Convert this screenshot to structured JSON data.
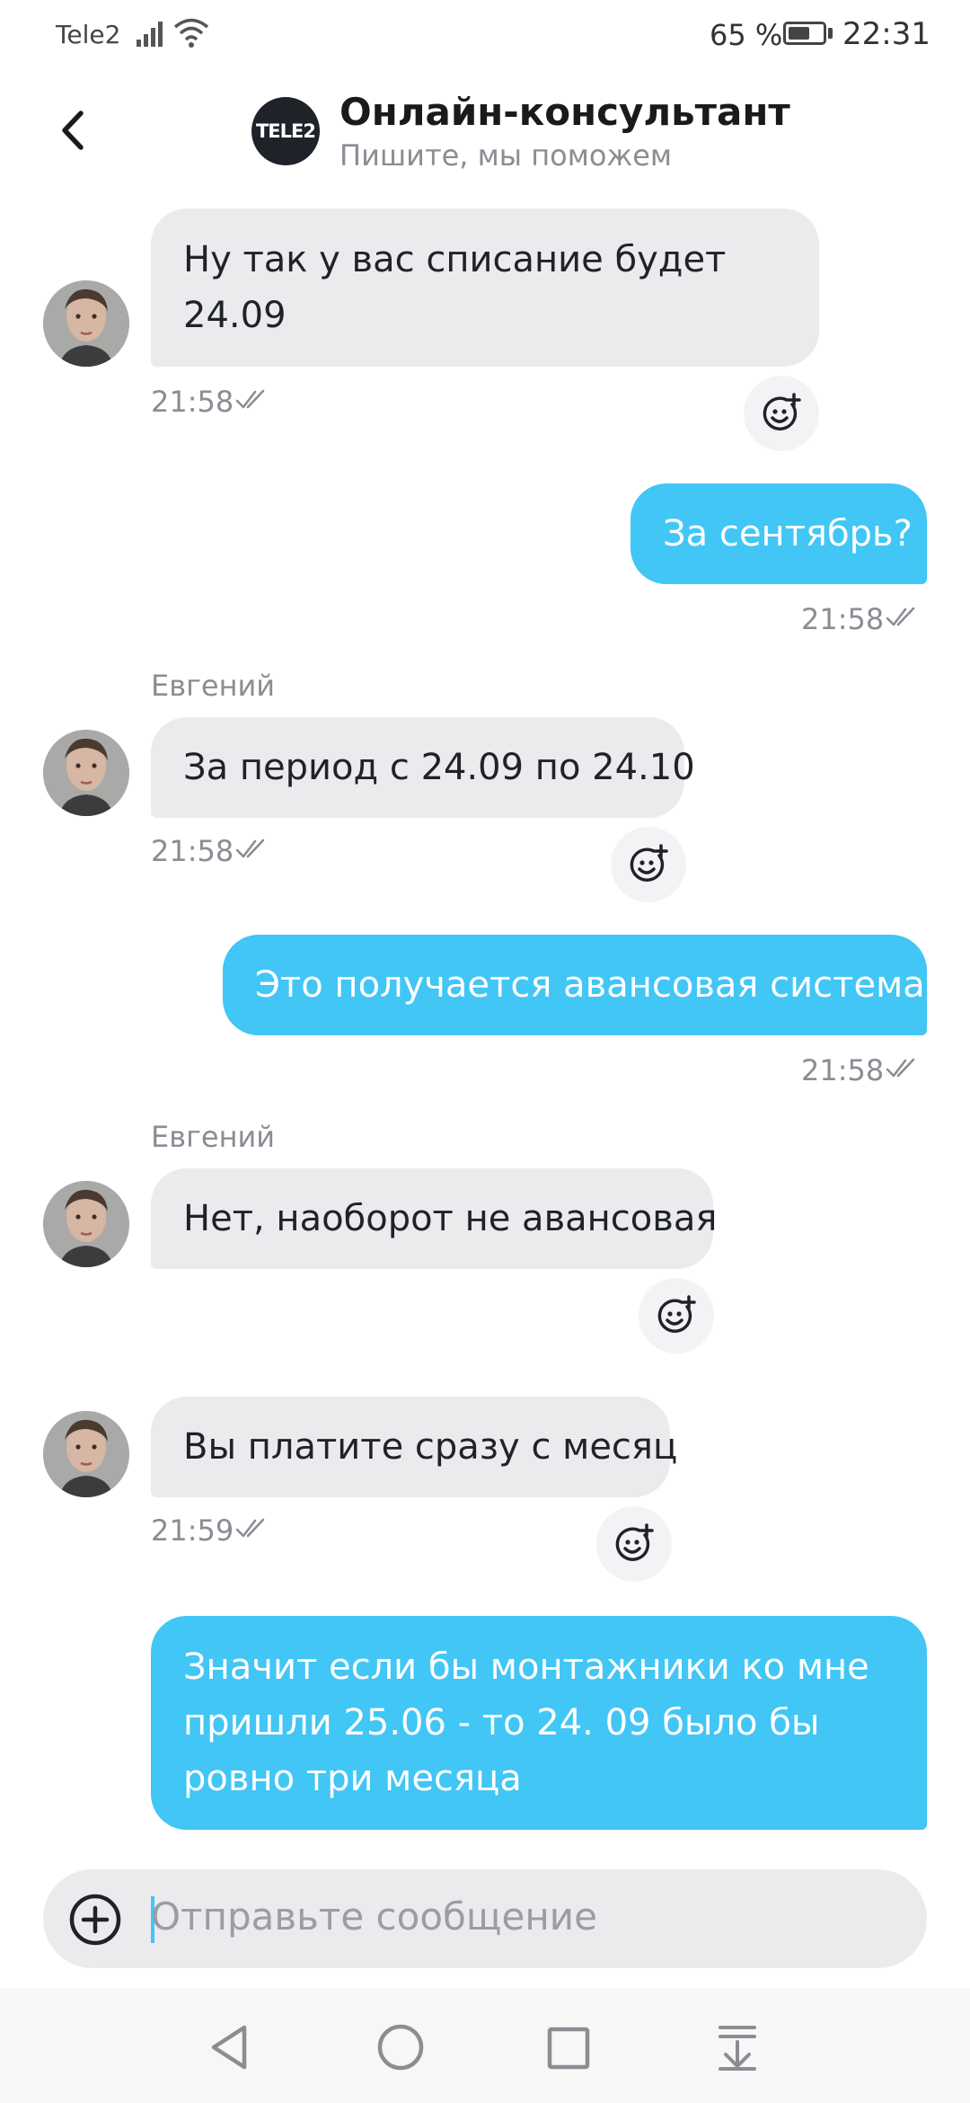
{
  "status_bar": {
    "carrier": "Tele2",
    "battery_percent": "65 %",
    "battery_level": 0.65,
    "time": "22:31"
  },
  "header": {
    "logo_text": "TELE2",
    "title": "Онлайн-консультант",
    "subtitle": "Пишите, мы поможем"
  },
  "messages": [
    {
      "direction": "in",
      "lines": [
        "Ну так у вас списание будет",
        "24.09"
      ],
      "time": "21:58"
    },
    {
      "direction": "out",
      "lines": [
        "За сентябрь?"
      ],
      "time": "21:58"
    },
    {
      "direction": "in",
      "sender": "Евгений",
      "lines": [
        "За период с 24.09 по 24.10"
      ],
      "time": "21:58"
    },
    {
      "direction": "out",
      "lines": [
        "Это получается авансовая система?"
      ],
      "time": "21:58"
    },
    {
      "direction": "in",
      "sender": "Евгений",
      "lines": [
        "Нет, наоборот не авансовая"
      ]
    },
    {
      "direction": "in",
      "lines": [
        "Вы платите сразу с месяц"
      ],
      "time": "21:59"
    },
    {
      "direction": "out",
      "lines": [
        "Значит если бы монтажники ко мне",
        "пришли 25.06 - то 24. 09 было бы",
        "ровно три месяца"
      ]
    }
  ],
  "composer": {
    "placeholder": "Отправьте сообщение"
  },
  "icons": {
    "back": "chevron-left-icon",
    "signal": "signal-icon",
    "wifi": "wifi-icon",
    "battery": "battery-icon",
    "ticks": "double-check-icon",
    "reaction": "add-reaction-icon",
    "attach": "plus-circle-icon",
    "nav": [
      "nav-back-icon",
      "nav-home-icon",
      "nav-recents-icon",
      "nav-notifications-icon"
    ]
  },
  "colors": {
    "outgoing_bubble": "#41c6f6",
    "incoming_bubble": "#ebebee",
    "muted_text": "#8a8d93"
  }
}
